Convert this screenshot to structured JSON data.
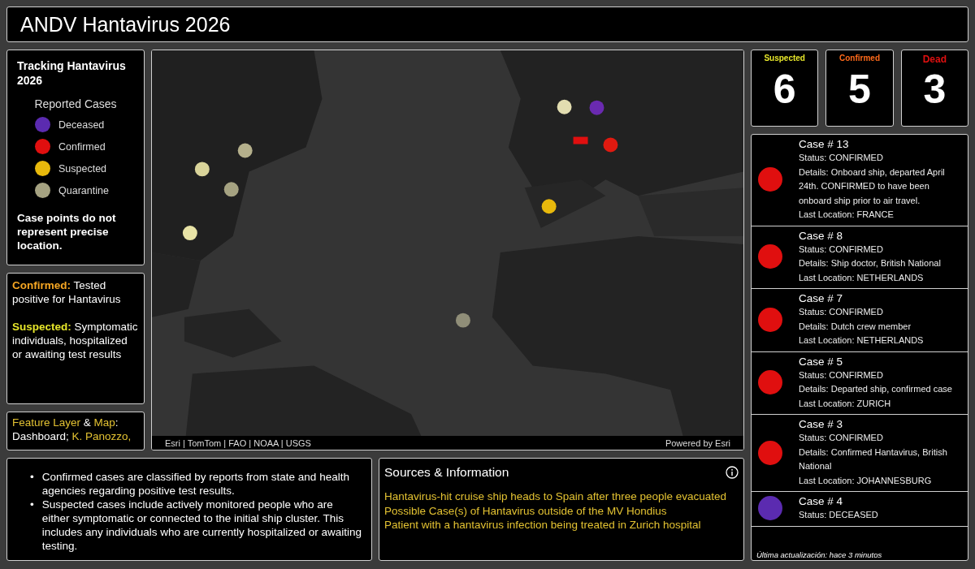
{
  "header": {
    "title": "ANDV Hantavirus 2026"
  },
  "legend": {
    "title": "Tracking Hantavirus 2026",
    "subtitle": "Reported Cases",
    "items": [
      {
        "label": "Deceased",
        "color": "#5b2bb0"
      },
      {
        "label": "Confirmed",
        "color": "#e00f0f"
      },
      {
        "label": "Suspected",
        "color": "#e8b90c"
      },
      {
        "label": "Quarantine",
        "color": "#a5a281"
      }
    ],
    "note": "Case points do not represent precise location."
  },
  "definitions": [
    {
      "term": "Confirmed:",
      "color": "#f5a623",
      "text": "Tested positive for Hantavirus"
    },
    {
      "term": "Suspected:",
      "color": "#e6e62a",
      "text": "Symptomatic individuals, hospitalized or awaiting test results"
    }
  ],
  "credits": [
    {
      "text": "Feature Layer",
      "highlight": true
    },
    {
      "text": " & ",
      "highlight": false
    },
    {
      "text": "Map",
      "highlight": true
    },
    {
      "text": ": Dashboard; ",
      "highlight": false
    },
    {
      "text": "K. Panozzo,",
      "highlight": true
    }
  ],
  "map": {
    "kind": "picture",
    "attribution": "Esri | TomTom | FAO | NOAA | USGS",
    "powered_by": "Powered by Esri"
  },
  "counters": [
    {
      "label": "Suspected",
      "color": "#e6e62a",
      "value": "6"
    },
    {
      "label": "Confirmed",
      "color": "#ff6a1a",
      "value": "5"
    },
    {
      "label": "Dead",
      "color": "#e01010",
      "value": "3"
    }
  ],
  "cases": [
    {
      "title": "Case # 13",
      "color": "#e00f0f",
      "lines": [
        "Status: CONFIRMED",
        "Details: Onboard ship, departed April 24th. CONFIRMED to have been onboard ship prior to air travel.",
        "Last Location: FRANCE"
      ]
    },
    {
      "title": "Case # 8",
      "color": "#e00f0f",
      "lines": [
        "Status: CONFIRMED",
        "Details: Ship doctor, British National",
        "Last Location: NETHERLANDS"
      ]
    },
    {
      "title": "Case # 7",
      "color": "#e00f0f",
      "lines": [
        "Status: CONFIRMED",
        "Details: Dutch crew member",
        "Last Location: NETHERLANDS"
      ]
    },
    {
      "title": "Case # 5",
      "color": "#e00f0f",
      "lines": [
        "Status: CONFIRMED",
        "Details: Departed ship, confirmed case",
        "Last Location: ZURICH"
      ]
    },
    {
      "title": "Case # 3",
      "color": "#e00f0f",
      "lines": [
        "Status: CONFIRMED",
        "Details: Confirmed Hantavirus, British National",
        "Last Location: JOHANNESBURG"
      ]
    },
    {
      "title": "Case # 4",
      "color": "#5b2bb0",
      "lines": [
        "Status: DECEASED"
      ]
    }
  ],
  "last_update": "Última actualización: hace 3 minutos",
  "notes": [
    {
      "marker": "•",
      "text": "Confirmed cases are classified by reports from state and health agencies regarding positive test results."
    },
    {
      "marker": "•",
      "text": "Suspected cases include actively monitored people who are either symptomatic or connected to the initial ship cluster. This includes any individuals who are currently hospitalized or awaiting testing."
    }
  ],
  "sources": {
    "title": "Sources & Information",
    "links": [
      "Hantavirus-hit cruise ship heads to Spain after three people evacuated",
      "Possible Case(s) of Hantavirus outside of the MV Hondius",
      "Patient with a hantavirus infection being treated in Zurich hospital"
    ]
  }
}
